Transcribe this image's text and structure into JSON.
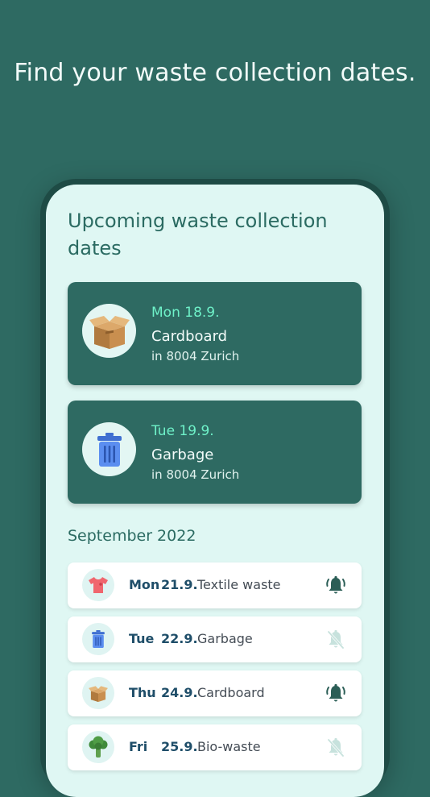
{
  "headline": "Find your waste collection dates.",
  "screen": {
    "title": "Upcoming waste collection dates",
    "upcoming": [
      {
        "date": "Mon 18.9.",
        "type": "Cardboard",
        "location": "in 8004 Zurich",
        "icon": "cardboard-box-icon"
      },
      {
        "date": "Tue 19.9.",
        "type": "Garbage",
        "location": "in 8004 Zurich",
        "icon": "trash-bin-icon"
      }
    ],
    "month": "September 2022",
    "schedule": [
      {
        "day": "Mon",
        "date": "21.9.",
        "type": "Textile waste",
        "icon": "tshirt-icon",
        "reminder": "bell-on-icon"
      },
      {
        "day": "Tue",
        "date": "22.9.",
        "type": "Garbage",
        "icon": "trash-bin-icon",
        "reminder": "bell-off-icon"
      },
      {
        "day": "Thu",
        "date": "24.9.",
        "type": "Cardboard",
        "icon": "cardboard-box-icon",
        "reminder": "bell-on-icon"
      },
      {
        "day": "Fri",
        "date": "25.9.",
        "type": "Bio-waste",
        "icon": "broccoli-icon",
        "reminder": "bell-off-icon"
      }
    ]
  },
  "colors": {
    "background": "#2e6a62",
    "screen": "#dff7f3",
    "accent_date": "#6ff2c9",
    "bell_on": "#2b5e56",
    "bell_off": "#c7e2dd"
  }
}
